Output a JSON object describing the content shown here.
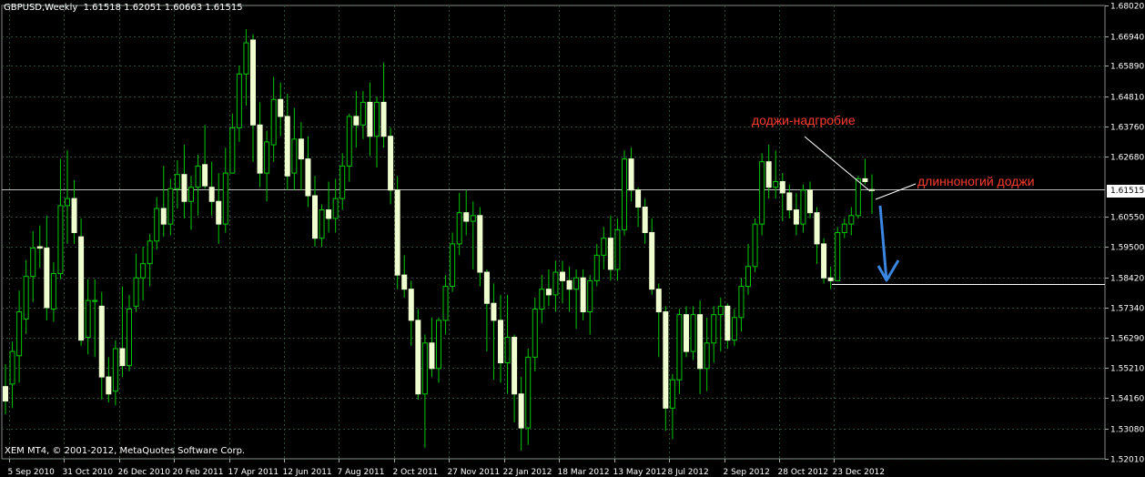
{
  "header": {
    "symbol": "GBPUSD,Weekly",
    "ohlc": "1.61518 1.62051 1.60663 1.61515"
  },
  "copyright": "XEM MT4, © 2001-2012, MetaQuotes Software Corp.",
  "annotations": {
    "gravestone": "доджи-надгробие",
    "longlegged": "длинноногий доджи"
  },
  "colors": {
    "background": "#000000",
    "grid": "#2e4e38",
    "candle_wick": "#00c800",
    "bull_body": "#000000",
    "bear_body": "#f0ffd0",
    "axis_text": "#ffffff",
    "annotation": "#ff3b30",
    "arrow": "#3a86e0"
  },
  "chart_data": {
    "type": "candlestick",
    "title": "GBPUSD,Weekly",
    "symbol": "GBPUSD",
    "timeframe": "Weekly",
    "last_ohlc": {
      "open": 1.61518,
      "high": 1.62051,
      "low": 1.60663,
      "close": 1.61515
    },
    "current_price": "1.61515",
    "y_ticks": [
      "1.68020",
      "1.66940",
      "1.65890",
      "1.64810",
      "1.63760",
      "1.62680",
      "1.60550",
      "1.59500",
      "1.58420",
      "1.57340",
      "1.56290",
      "1.55210",
      "1.54160",
      "1.53080",
      "1.52010"
    ],
    "ylim": [
      1.5201,
      1.6802
    ],
    "x_ticks": [
      "5 Sep 2010",
      "31 Oct 2010",
      "26 Dec 2010",
      "20 Feb 2011",
      "17 Apr 2011",
      "12 Jun 2011",
      "7 Aug 2011",
      "2 Oct 2011",
      "27 Nov 2011",
      "22 Jan 2012",
      "18 Mar 2012",
      "13 May 2012",
      "8 Jul 2012",
      "2 Sep 2012",
      "28 Oct 2012",
      "23 Dec 2012"
    ],
    "grid": true,
    "support_level": 1.5819,
    "candles": [
      {
        "o": 1.5456,
        "h": 1.5535,
        "l": 1.5358,
        "c": 1.5405
      },
      {
        "o": 1.5465,
        "h": 1.5615,
        "l": 1.538,
        "c": 1.558
      },
      {
        "o": 1.5565,
        "h": 1.5795,
        "l": 1.547,
        "c": 1.572
      },
      {
        "o": 1.5695,
        "h": 1.5903,
        "l": 1.5642,
        "c": 1.5845
      },
      {
        "o": 1.5845,
        "h": 1.6005,
        "l": 1.5755,
        "c": 1.5945
      },
      {
        "o": 1.595,
        "h": 1.6025,
        "l": 1.5875,
        "c": 1.5945
      },
      {
        "o": 1.5945,
        "h": 1.606,
        "l": 1.569,
        "c": 1.5735
      },
      {
        "o": 1.573,
        "h": 1.5895,
        "l": 1.5685,
        "c": 1.5855
      },
      {
        "o": 1.5855,
        "h": 1.626,
        "l": 1.5835,
        "c": 1.6095
      },
      {
        "o": 1.6095,
        "h": 1.629,
        "l": 1.596,
        "c": 1.612
      },
      {
        "o": 1.612,
        "h": 1.6185,
        "l": 1.596,
        "c": 1.6
      },
      {
        "o": 1.5985,
        "h": 1.605,
        "l": 1.56,
        "c": 1.562
      },
      {
        "o": 1.563,
        "h": 1.5835,
        "l": 1.557,
        "c": 1.576
      },
      {
        "o": 1.576,
        "h": 1.5835,
        "l": 1.556,
        "c": 1.576
      },
      {
        "o": 1.574,
        "h": 1.579,
        "l": 1.541,
        "c": 1.549
      },
      {
        "o": 1.549,
        "h": 1.556,
        "l": 1.54,
        "c": 1.543
      },
      {
        "o": 1.544,
        "h": 1.562,
        "l": 1.539,
        "c": 1.559
      },
      {
        "o": 1.559,
        "h": 1.581,
        "l": 1.549,
        "c": 1.553
      },
      {
        "o": 1.553,
        "h": 1.578,
        "l": 1.551,
        "c": 1.573
      },
      {
        "o": 1.574,
        "h": 1.5925,
        "l": 1.572,
        "c": 1.584
      },
      {
        "o": 1.584,
        "h": 1.595,
        "l": 1.576,
        "c": 1.589
      },
      {
        "o": 1.589,
        "h": 1.5995,
        "l": 1.581,
        "c": 1.597
      },
      {
        "o": 1.597,
        "h": 1.6125,
        "l": 1.594,
        "c": 1.6085
      },
      {
        "o": 1.6085,
        "h": 1.6235,
        "l": 1.5985,
        "c": 1.603
      },
      {
        "o": 1.603,
        "h": 1.619,
        "l": 1.599,
        "c": 1.6155
      },
      {
        "o": 1.6155,
        "h": 1.6255,
        "l": 1.6085,
        "c": 1.6205
      },
      {
        "o": 1.6205,
        "h": 1.631,
        "l": 1.605,
        "c": 1.611
      },
      {
        "o": 1.611,
        "h": 1.62,
        "l": 1.601,
        "c": 1.616
      },
      {
        "o": 1.616,
        "h": 1.6275,
        "l": 1.606,
        "c": 1.6235
      },
      {
        "o": 1.624,
        "h": 1.638,
        "l": 1.6155,
        "c": 1.6165
      },
      {
        "o": 1.616,
        "h": 1.625,
        "l": 1.606,
        "c": 1.611
      },
      {
        "o": 1.611,
        "h": 1.621,
        "l": 1.596,
        "c": 1.603
      },
      {
        "o": 1.603,
        "h": 1.63,
        "l": 1.6,
        "c": 1.621
      },
      {
        "o": 1.621,
        "h": 1.642,
        "l": 1.621,
        "c": 1.637
      },
      {
        "o": 1.637,
        "h": 1.659,
        "l": 1.632,
        "c": 1.656
      },
      {
        "o": 1.656,
        "h": 1.6718,
        "l": 1.6448,
        "c": 1.667
      },
      {
        "o": 1.668,
        "h": 1.67,
        "l": 1.625,
        "c": 1.638
      },
      {
        "o": 1.638,
        "h": 1.646,
        "l": 1.616,
        "c": 1.621
      },
      {
        "o": 1.621,
        "h": 1.636,
        "l": 1.611,
        "c": 1.632
      },
      {
        "o": 1.631,
        "h": 1.655,
        "l": 1.625,
        "c": 1.647
      },
      {
        "o": 1.647,
        "h": 1.653,
        "l": 1.634,
        "c": 1.641
      },
      {
        "o": 1.641,
        "h": 1.649,
        "l": 1.615,
        "c": 1.62
      },
      {
        "o": 1.621,
        "h": 1.644,
        "l": 1.615,
        "c": 1.633
      },
      {
        "o": 1.633,
        "h": 1.639,
        "l": 1.615,
        "c": 1.626
      },
      {
        "o": 1.626,
        "h": 1.634,
        "l": 1.609,
        "c": 1.613
      },
      {
        "o": 1.613,
        "h": 1.62,
        "l": 1.595,
        "c": 1.598
      },
      {
        "o": 1.598,
        "h": 1.61,
        "l": 1.595,
        "c": 1.608
      },
      {
        "o": 1.608,
        "h": 1.618,
        "l": 1.6,
        "c": 1.605
      },
      {
        "o": 1.605,
        "h": 1.619,
        "l": 1.6,
        "c": 1.612
      },
      {
        "o": 1.612,
        "h": 1.628,
        "l": 1.608,
        "c": 1.6235
      },
      {
        "o": 1.6235,
        "h": 1.642,
        "l": 1.618,
        "c": 1.641
      },
      {
        "o": 1.641,
        "h": 1.65,
        "l": 1.63,
        "c": 1.638
      },
      {
        "o": 1.638,
        "h": 1.65,
        "l": 1.633,
        "c": 1.646
      },
      {
        "o": 1.646,
        "h": 1.653,
        "l": 1.627,
        "c": 1.634
      },
      {
        "o": 1.634,
        "h": 1.648,
        "l": 1.623,
        "c": 1.646
      },
      {
        "o": 1.646,
        "h": 1.66,
        "l": 1.63,
        "c": 1.634
      },
      {
        "o": 1.634,
        "h": 1.637,
        "l": 1.61,
        "c": 1.615
      },
      {
        "o": 1.615,
        "h": 1.62,
        "l": 1.58,
        "c": 1.585
      },
      {
        "o": 1.585,
        "h": 1.592,
        "l": 1.577,
        "c": 1.58
      },
      {
        "o": 1.58,
        "h": 1.583,
        "l": 1.56,
        "c": 1.569
      },
      {
        "o": 1.569,
        "h": 1.573,
        "l": 1.541,
        "c": 1.543
      },
      {
        "o": 1.543,
        "h": 1.564,
        "l": 1.524,
        "c": 1.561
      },
      {
        "o": 1.561,
        "h": 1.57,
        "l": 1.549,
        "c": 1.552
      },
      {
        "o": 1.552,
        "h": 1.57,
        "l": 1.547,
        "c": 1.569
      },
      {
        "o": 1.569,
        "h": 1.585,
        "l": 1.564,
        "c": 1.581
      },
      {
        "o": 1.581,
        "h": 1.6,
        "l": 1.579,
        "c": 1.596
      },
      {
        "o": 1.596,
        "h": 1.614,
        "l": 1.592,
        "c": 1.607
      },
      {
        "o": 1.607,
        "h": 1.615,
        "l": 1.599,
        "c": 1.604
      },
      {
        "o": 1.604,
        "h": 1.611,
        "l": 1.587,
        "c": 1.606
      },
      {
        "o": 1.606,
        "h": 1.609,
        "l": 1.581,
        "c": 1.586
      },
      {
        "o": 1.586,
        "h": 1.587,
        "l": 1.558,
        "c": 1.575
      },
      {
        "o": 1.575,
        "h": 1.582,
        "l": 1.548,
        "c": 1.569
      },
      {
        "o": 1.569,
        "h": 1.578,
        "l": 1.547,
        "c": 1.554
      },
      {
        "o": 1.554,
        "h": 1.578,
        "l": 1.543,
        "c": 1.563
      },
      {
        "o": 1.563,
        "h": 1.564,
        "l": 1.533,
        "c": 1.543
      },
      {
        "o": 1.543,
        "h": 1.549,
        "l": 1.523,
        "c": 1.531
      },
      {
        "o": 1.531,
        "h": 1.559,
        "l": 1.525,
        "c": 1.556
      },
      {
        "o": 1.556,
        "h": 1.577,
        "l": 1.551,
        "c": 1.573
      },
      {
        "o": 1.573,
        "h": 1.585,
        "l": 1.568,
        "c": 1.58
      },
      {
        "o": 1.58,
        "h": 1.587,
        "l": 1.574,
        "c": 1.578
      },
      {
        "o": 1.578,
        "h": 1.59,
        "l": 1.572,
        "c": 1.586
      },
      {
        "o": 1.586,
        "h": 1.59,
        "l": 1.575,
        "c": 1.583
      },
      {
        "o": 1.583,
        "h": 1.588,
        "l": 1.572,
        "c": 1.58
      },
      {
        "o": 1.58,
        "h": 1.587,
        "l": 1.566,
        "c": 1.584
      },
      {
        "o": 1.584,
        "h": 1.587,
        "l": 1.569,
        "c": 1.572
      },
      {
        "o": 1.572,
        "h": 1.585,
        "l": 1.564,
        "c": 1.583
      },
      {
        "o": 1.583,
        "h": 1.596,
        "l": 1.581,
        "c": 1.592
      },
      {
        "o": 1.592,
        "h": 1.602,
        "l": 1.587,
        "c": 1.598
      },
      {
        "o": 1.598,
        "h": 1.606,
        "l": 1.583,
        "c": 1.587
      },
      {
        "o": 1.587,
        "h": 1.605,
        "l": 1.583,
        "c": 1.601
      },
      {
        "o": 1.601,
        "h": 1.629,
        "l": 1.599,
        "c": 1.626
      },
      {
        "o": 1.626,
        "h": 1.63,
        "l": 1.611,
        "c": 1.615
      },
      {
        "o": 1.615,
        "h": 1.616,
        "l": 1.602,
        "c": 1.609
      },
      {
        "o": 1.609,
        "h": 1.612,
        "l": 1.596,
        "c": 1.6
      },
      {
        "o": 1.6,
        "h": 1.605,
        "l": 1.578,
        "c": 1.58
      },
      {
        "o": 1.58,
        "h": 1.582,
        "l": 1.556,
        "c": 1.572
      },
      {
        "o": 1.572,
        "h": 1.574,
        "l": 1.53,
        "c": 1.538
      },
      {
        "o": 1.538,
        "h": 1.55,
        "l": 1.527,
        "c": 1.548
      },
      {
        "o": 1.548,
        "h": 1.573,
        "l": 1.543,
        "c": 1.571
      },
      {
        "o": 1.571,
        "h": 1.574,
        "l": 1.556,
        "c": 1.558
      },
      {
        "o": 1.558,
        "h": 1.574,
        "l": 1.555,
        "c": 1.571
      },
      {
        "o": 1.571,
        "h": 1.576,
        "l": 1.543,
        "c": 1.552
      },
      {
        "o": 1.552,
        "h": 1.57,
        "l": 1.544,
        "c": 1.561
      },
      {
        "o": 1.561,
        "h": 1.574,
        "l": 1.554,
        "c": 1.571
      },
      {
        "o": 1.571,
        "h": 1.577,
        "l": 1.558,
        "c": 1.574
      },
      {
        "o": 1.574,
        "h": 1.575,
        "l": 1.559,
        "c": 1.562
      },
      {
        "o": 1.562,
        "h": 1.573,
        "l": 1.56,
        "c": 1.57
      },
      {
        "o": 1.57,
        "h": 1.584,
        "l": 1.565,
        "c": 1.581
      },
      {
        "o": 1.581,
        "h": 1.596,
        "l": 1.578,
        "c": 1.588
      },
      {
        "o": 1.588,
        "h": 1.605,
        "l": 1.586,
        "c": 1.603
      },
      {
        "o": 1.603,
        "h": 1.628,
        "l": 1.599,
        "c": 1.625
      },
      {
        "o": 1.625,
        "h": 1.631,
        "l": 1.612,
        "c": 1.616
      },
      {
        "o": 1.616,
        "h": 1.629,
        "l": 1.612,
        "c": 1.618
      },
      {
        "o": 1.618,
        "h": 1.621,
        "l": 1.604,
        "c": 1.614
      },
      {
        "o": 1.614,
        "h": 1.617,
        "l": 1.605,
        "c": 1.608
      },
      {
        "o": 1.608,
        "h": 1.614,
        "l": 1.599,
        "c": 1.603
      },
      {
        "o": 1.603,
        "h": 1.617,
        "l": 1.6,
        "c": 1.615
      },
      {
        "o": 1.615,
        "h": 1.618,
        "l": 1.605,
        "c": 1.607
      },
      {
        "o": 1.607,
        "h": 1.609,
        "l": 1.589,
        "c": 1.596
      },
      {
        "o": 1.596,
        "h": 1.598,
        "l": 1.582,
        "c": 1.584
      },
      {
        "o": 1.584,
        "h": 1.588,
        "l": 1.58,
        "c": 1.583
      },
      {
        "o": 1.583,
        "h": 1.602,
        "l": 1.583,
        "c": 1.6
      },
      {
        "o": 1.6,
        "h": 1.605,
        "l": 1.598,
        "c": 1.603
      },
      {
        "o": 1.603,
        "h": 1.609,
        "l": 1.599,
        "c": 1.606
      },
      {
        "o": 1.606,
        "h": 1.62,
        "l": 1.605,
        "c": 1.619
      },
      {
        "o": 1.619,
        "h": 1.626,
        "l": 1.617,
        "c": 1.618
      },
      {
        "o": 1.61518,
        "h": 1.62051,
        "l": 1.60663,
        "c": 1.61515
      }
    ]
  }
}
